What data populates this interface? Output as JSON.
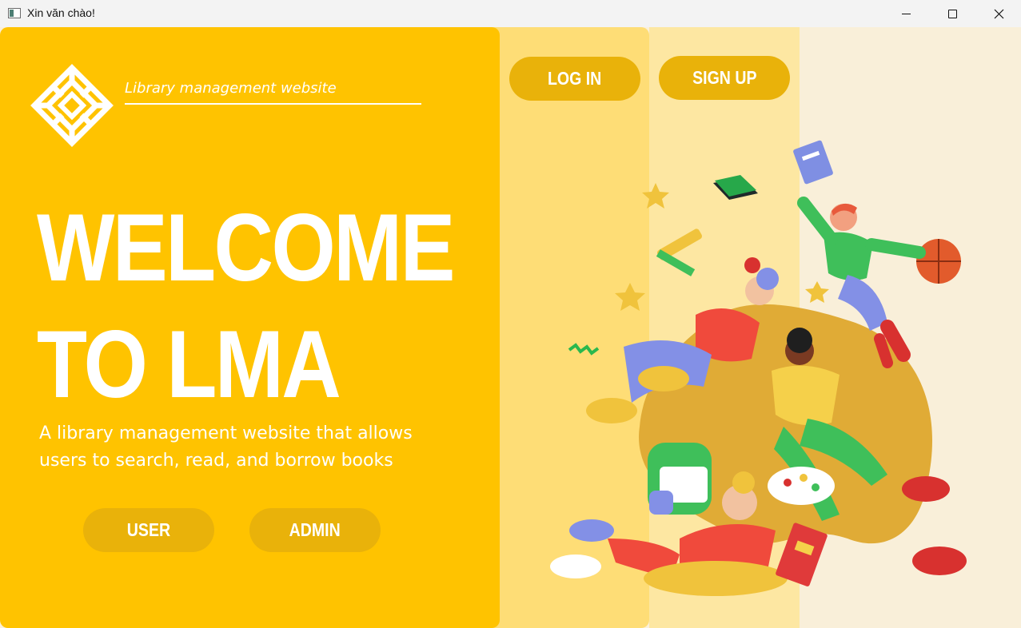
{
  "window": {
    "title": "Xin văn chào!",
    "controls": [
      "minimize",
      "maximize",
      "close"
    ]
  },
  "brand": {
    "subtitle": "Library management website",
    "logo_icon": "geometric-knot-logo"
  },
  "hero": {
    "line1": "WELCOME",
    "line2": "TO LMA",
    "description": "A library management website that allows users to search, read, and borrow books"
  },
  "buttons": {
    "user": "USER",
    "admin": "ADMIN",
    "login": "LOG IN",
    "signup": "SIGN UP"
  },
  "colors": {
    "panel": "#ffc300",
    "button": "#e9b20a",
    "band_mid": "#fedd76",
    "band_light": "#fde7a2",
    "band_cream": "#f9efd9"
  },
  "illustration": {
    "icon": "students-floating-illustration"
  }
}
